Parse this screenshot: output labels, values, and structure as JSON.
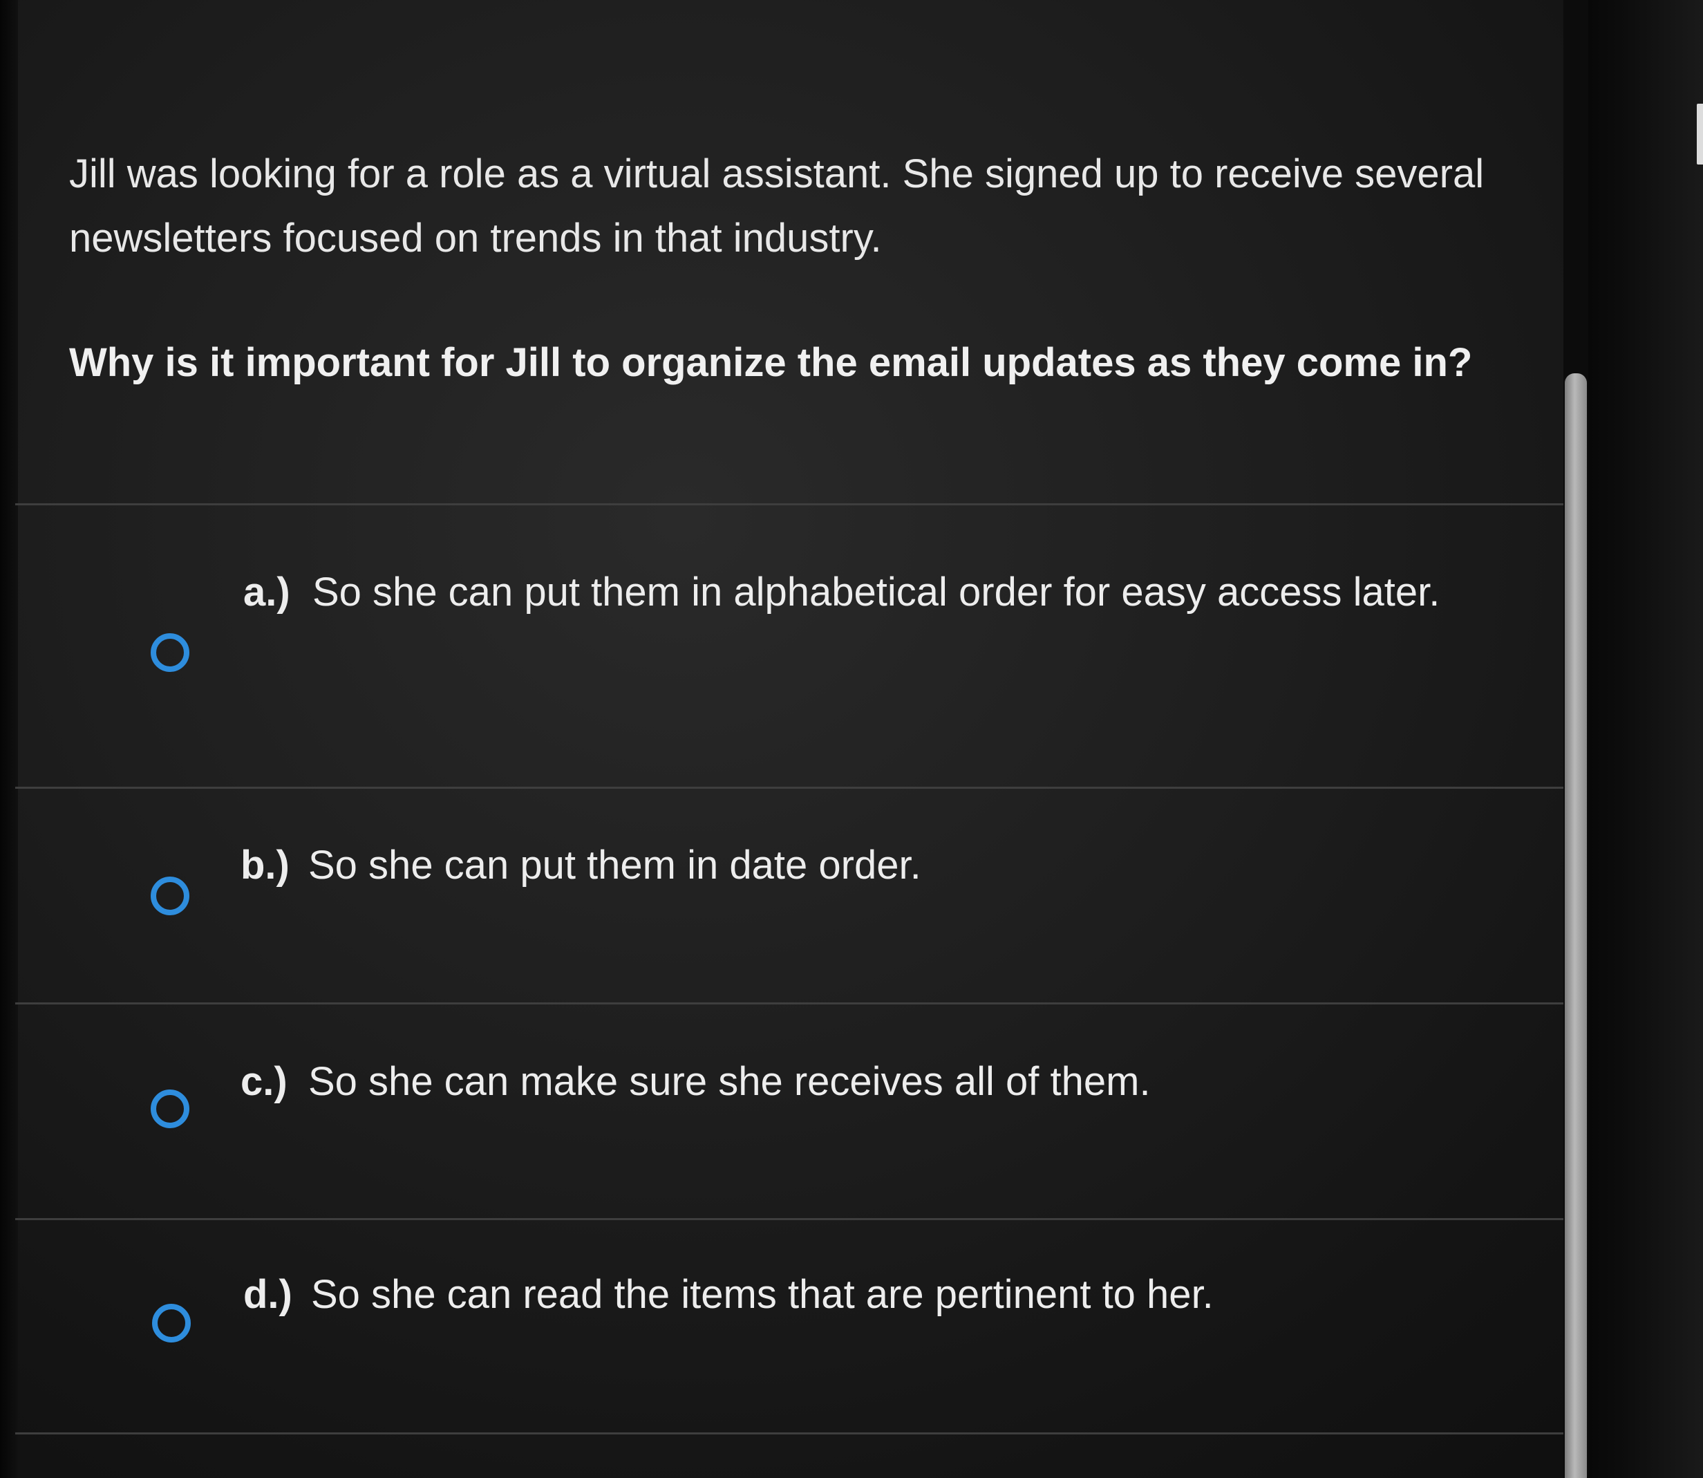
{
  "question": {
    "stem": "Jill was looking for a role as a virtual assistant. She signed up to receive several newsletters focused on trends in that industry.",
    "prompt": "Why is it important for Jill to organize the email updates as they come in?"
  },
  "options": [
    {
      "letter": "a.)",
      "text": "So she can put them in alphabetical order for easy access later."
    },
    {
      "letter": "b.)",
      "text": "So she can put them in date order."
    },
    {
      "letter": "c.)",
      "text": "So she can make sure she receives all of them."
    },
    {
      "letter": "d.)",
      "text": "So she can read the items that are pertinent to her."
    }
  ],
  "colors": {
    "radio_accent": "#2e8ddd",
    "background": "#1d1d1d",
    "text": "#ededed"
  }
}
